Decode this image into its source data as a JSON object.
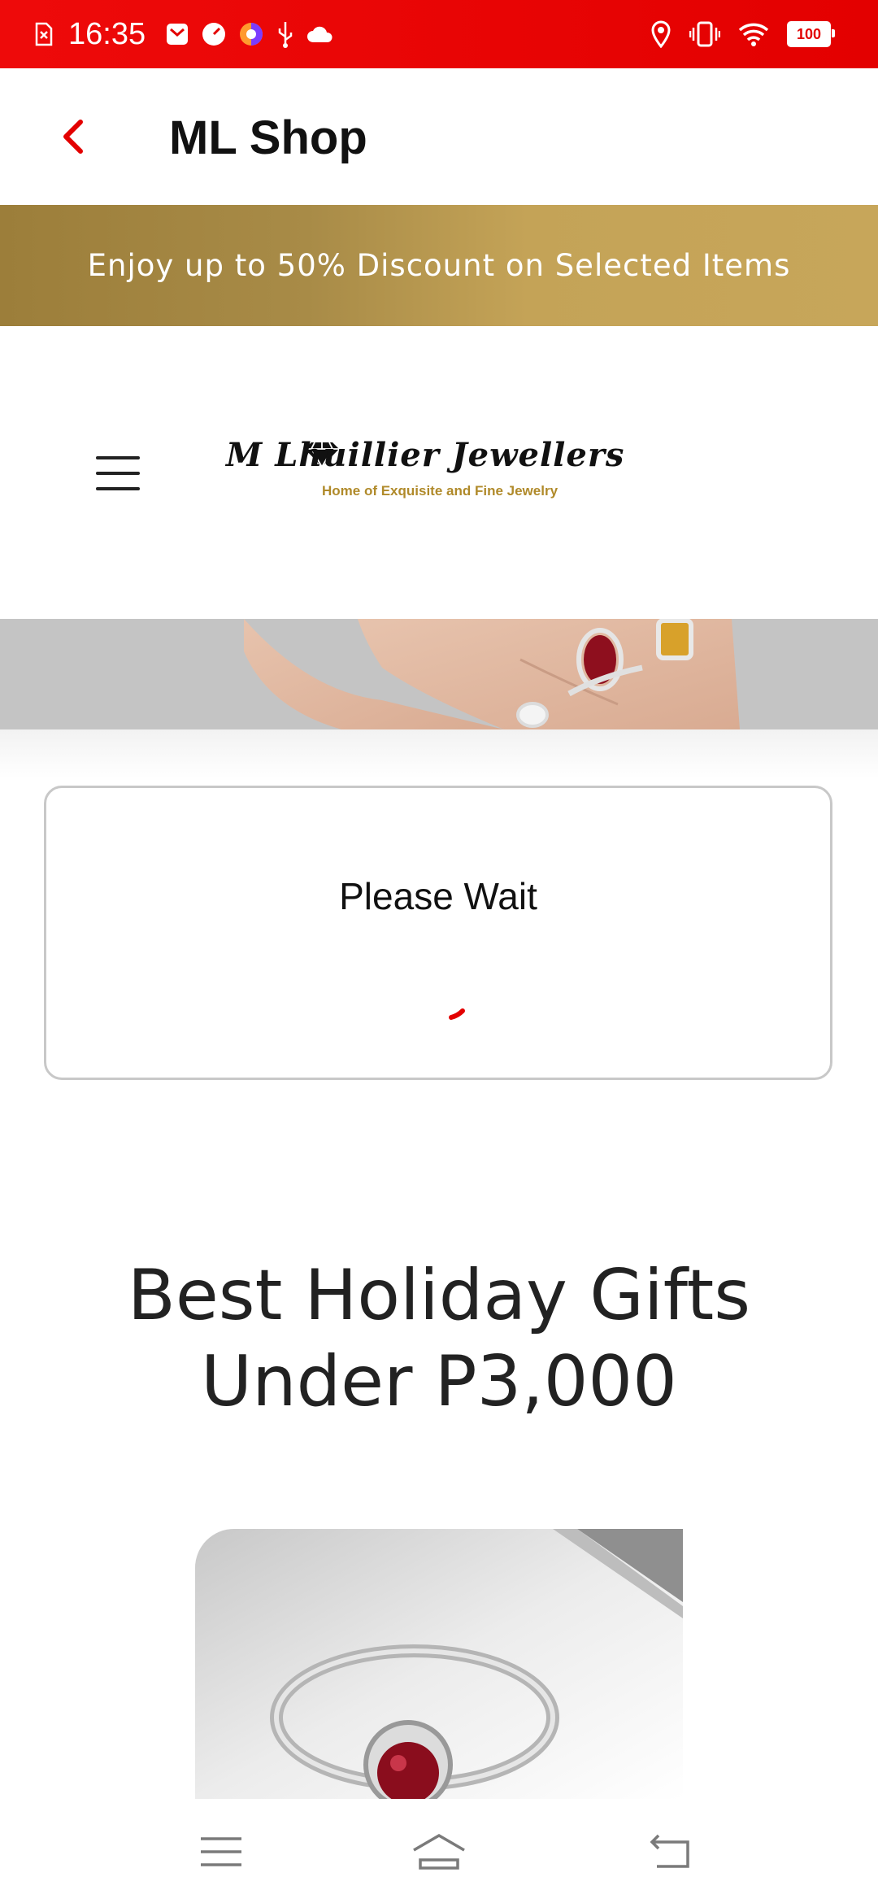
{
  "status_bar": {
    "time": "16:35",
    "battery": "100",
    "icons": [
      "sim-error-icon",
      "mail-icon",
      "speed-icon",
      "browser-icon",
      "usb-icon",
      "cloud-icon",
      "location-icon",
      "vibrate-icon",
      "wifi-icon",
      "battery-icon"
    ]
  },
  "app_bar": {
    "title": "ML Shop",
    "back_icon": "chevron-left-icon",
    "accent_color": "#e30000"
  },
  "promo": {
    "text": "Enjoy up to 50% Discount on Selected Items"
  },
  "site_header": {
    "menu_icon": "hamburger-menu-icon",
    "logo_name": "M Lhuillier Jewellers",
    "logo_tagline": "Home of Exquisite and Fine Jewelry"
  },
  "dialog": {
    "message": "Please Wait"
  },
  "section": {
    "title": "Best Holiday Gifts Under P3,000"
  },
  "nav": {
    "icons": [
      "recents-icon",
      "home-icon",
      "back-icon"
    ]
  }
}
